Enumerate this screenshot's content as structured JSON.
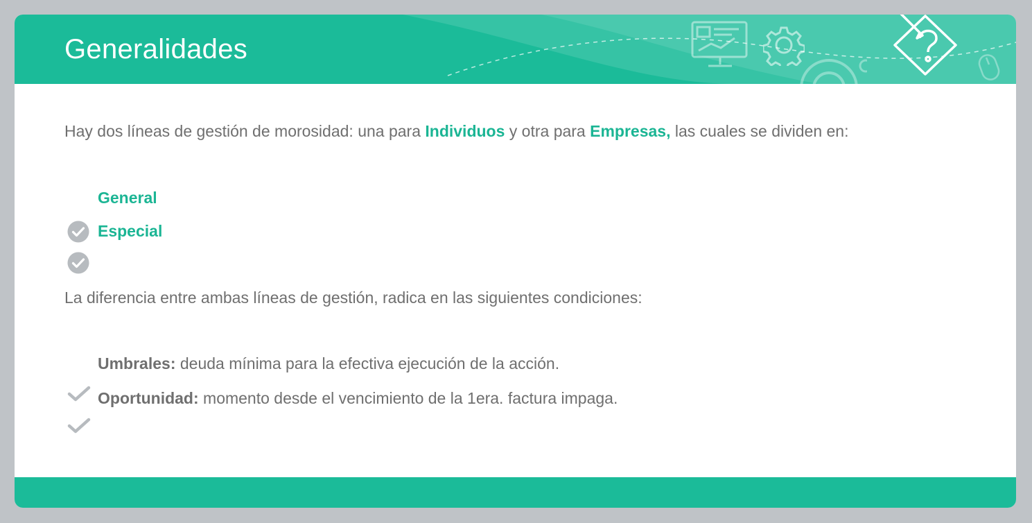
{
  "header": {
    "title": "Generalidades",
    "accent_color": "#1bbb99",
    "icons": [
      "presentation-screen-icon",
      "gear-icon",
      "large-gear-icon",
      "pencil-question-icon",
      "mouse-icon"
    ]
  },
  "intro": {
    "prefix": "Hay dos líneas de gestión de morosidad: una para ",
    "term1": "Individuos",
    "middle": " y otra para ",
    "term2": "Empresas,",
    "suffix": " las cuales se dividen en:"
  },
  "lines": {
    "items": [
      "General",
      "Especial"
    ],
    "icon": "check-circle-icon"
  },
  "difference": {
    "text": "La diferencia entre ambas líneas de gestión, radica en las siguientes condiciones:"
  },
  "conditions": [
    {
      "term": "Umbrales:",
      "desc": " deuda mínima para la efectiva ejecución de la acción."
    },
    {
      "term": "Oportunidad:",
      "desc": " momento desde el vencimiento de la 1era.  factura impaga."
    }
  ]
}
